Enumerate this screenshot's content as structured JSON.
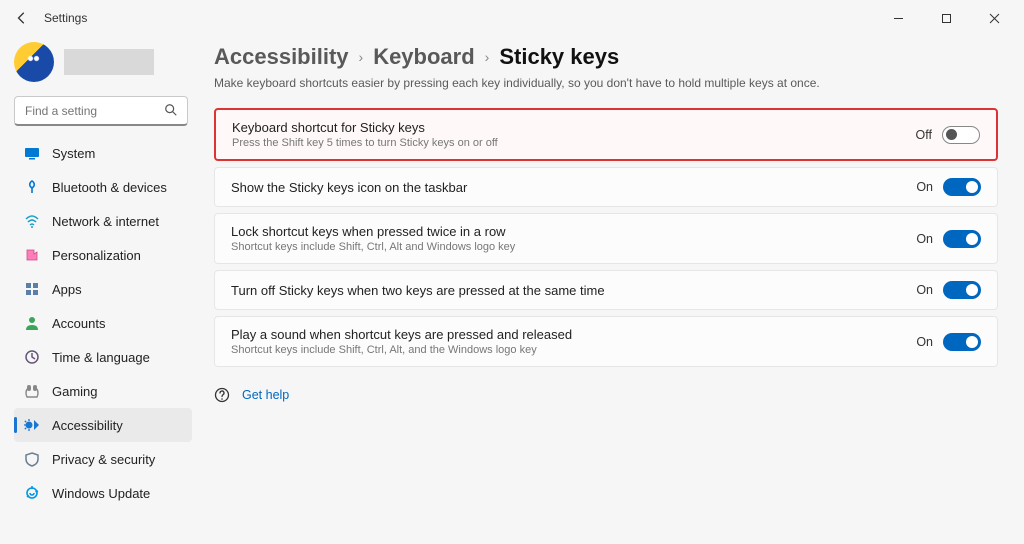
{
  "window": {
    "title": "Settings"
  },
  "search": {
    "placeholder": "Find a setting"
  },
  "sidebar": {
    "items": [
      {
        "label": "System"
      },
      {
        "label": "Bluetooth & devices"
      },
      {
        "label": "Network & internet"
      },
      {
        "label": "Personalization"
      },
      {
        "label": "Apps"
      },
      {
        "label": "Accounts"
      },
      {
        "label": "Time & language"
      },
      {
        "label": "Gaming"
      },
      {
        "label": "Accessibility"
      },
      {
        "label": "Privacy & security"
      },
      {
        "label": "Windows Update"
      }
    ]
  },
  "breadcrumb": {
    "a": "Accessibility",
    "b": "Keyboard",
    "current": "Sticky keys"
  },
  "page_subtitle": "Make keyboard shortcuts easier by pressing each key individually, so you don't have to hold multiple keys at once.",
  "settings": [
    {
      "title": "Keyboard shortcut for Sticky keys",
      "sub": "Press the Shift key 5 times to turn Sticky keys on or off",
      "state": "Off",
      "on": false,
      "highlight": true
    },
    {
      "title": "Show the Sticky keys icon on the taskbar",
      "sub": "",
      "state": "On",
      "on": true,
      "highlight": false
    },
    {
      "title": "Lock shortcut keys when pressed twice in a row",
      "sub": "Shortcut keys include Shift, Ctrl, Alt and Windows logo key",
      "state": "On",
      "on": true,
      "highlight": false
    },
    {
      "title": "Turn off Sticky keys when two keys are pressed at the same time",
      "sub": "",
      "state": "On",
      "on": true,
      "highlight": false
    },
    {
      "title": "Play a sound when shortcut keys are pressed and released",
      "sub": "Shortcut keys include Shift, Ctrl, Alt, and the Windows logo key",
      "state": "On",
      "on": true,
      "highlight": false
    }
  ],
  "help": {
    "label": "Get help"
  }
}
